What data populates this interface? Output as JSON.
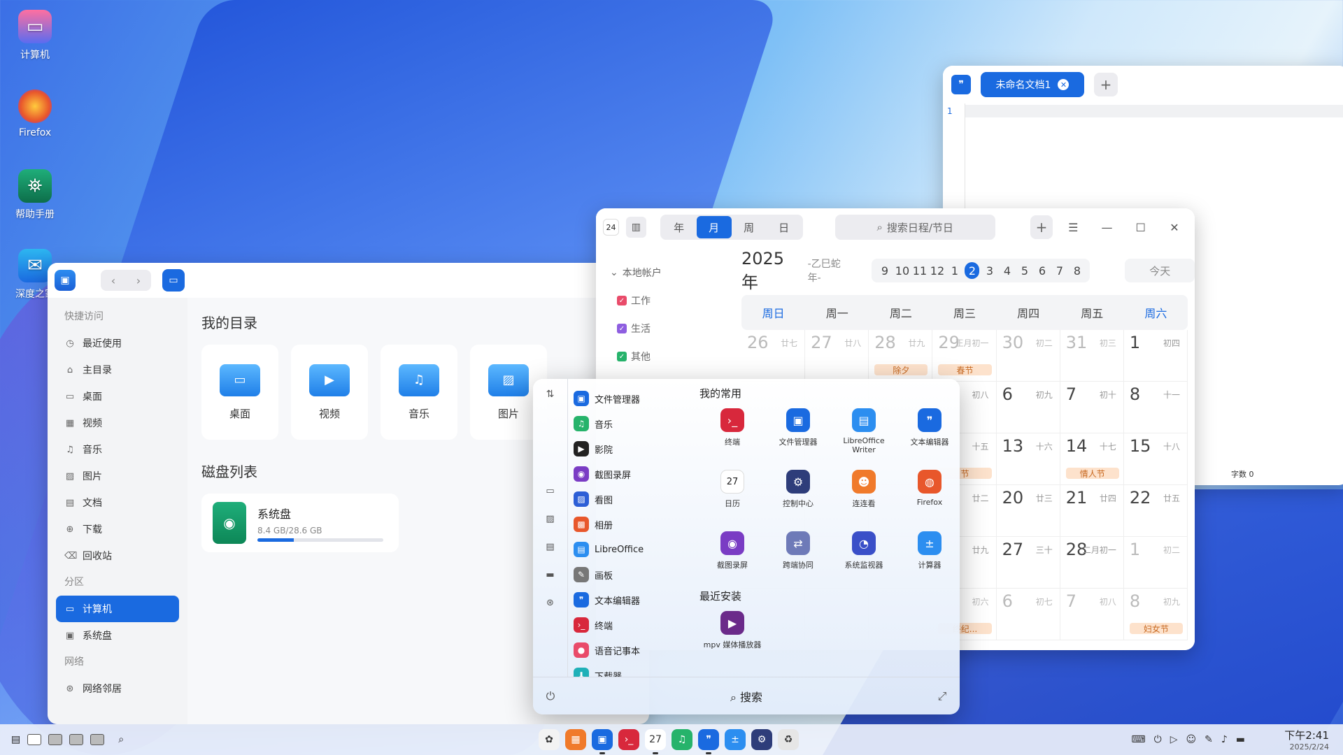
{
  "desktop": {
    "icons": [
      {
        "label": "计算机",
        "icon": "monitor-icon"
      },
      {
        "label": "Firefox",
        "icon": "firefox-icon"
      },
      {
        "label": "帮助手册",
        "icon": "manual-icon"
      },
      {
        "label": "深度之家",
        "icon": "deepin-home-icon"
      }
    ]
  },
  "file_manager": {
    "sidebar": {
      "quick_access": "快捷访问",
      "items": [
        "最近使用",
        "主目录",
        "桌面",
        "视频",
        "音乐",
        "图片",
        "文档",
        "下载",
        "回收站"
      ],
      "partitions_header": "分区",
      "partitions": [
        "计算机",
        "系统盘"
      ],
      "network_header": "网络",
      "network": [
        "网络邻居"
      ]
    },
    "my_dir_title": "我的目录",
    "folders": [
      "桌面",
      "视频",
      "音乐",
      "图片"
    ],
    "disk_title": "磁盘列表",
    "disk": {
      "name": "系统盘",
      "size": "8.4 GB/28.6 GB",
      "used_fraction": 0.29
    }
  },
  "text_editor": {
    "tab": "未命名文档1",
    "line_number": "1",
    "status": "字数 0"
  },
  "calendar": {
    "logo_text": "24",
    "views": [
      "年",
      "月",
      "周",
      "日"
    ],
    "active_view": "月",
    "search_placeholder": "搜索日程/节日",
    "account": "本地帐户",
    "types": [
      {
        "label": "工作",
        "color": "#e94b6a"
      },
      {
        "label": "生活",
        "color": "#8e5ee0"
      },
      {
        "label": "其他",
        "color": "#26b36b"
      }
    ],
    "year": "2025年",
    "ganzhi": "-乙巳蛇年-",
    "months": [
      "9",
      "10",
      "11",
      "12",
      "1",
      "2",
      "3",
      "4",
      "5",
      "6",
      "7",
      "8"
    ],
    "active_month": "2",
    "today": "今天",
    "weekdays": [
      "周日",
      "周一",
      "周二",
      "周三",
      "周四",
      "周五",
      "周六"
    ],
    "cells": [
      {
        "d": "26",
        "l": "廿七",
        "dim": true
      },
      {
        "d": "27",
        "l": "廿八",
        "dim": true
      },
      {
        "d": "28",
        "l": "廿九",
        "dim": true,
        "tag": "除夕"
      },
      {
        "d": "29",
        "l": "正月初一",
        "dim": true,
        "tag": "春节"
      },
      {
        "d": "30",
        "l": "初二",
        "dim": true
      },
      {
        "d": "31",
        "l": "初三",
        "dim": true
      },
      {
        "d": "1",
        "l": "初四"
      },
      {
        "d": "",
        "l": ""
      },
      {
        "d": "",
        "l": ""
      },
      {
        "d": "",
        "l": ""
      },
      {
        "d": "",
        "l": "初八"
      },
      {
        "d": "6",
        "l": "初九"
      },
      {
        "d": "7",
        "l": "初十"
      },
      {
        "d": "8",
        "l": "十一"
      },
      {
        "d": "",
        "l": ""
      },
      {
        "d": "",
        "l": ""
      },
      {
        "d": "",
        "l": ""
      },
      {
        "d": "",
        "l": "十五",
        "tag": "节"
      },
      {
        "d": "13",
        "l": "十六"
      },
      {
        "d": "14",
        "l": "十七",
        "tag": "情人节"
      },
      {
        "d": "15",
        "l": "十八"
      },
      {
        "d": "",
        "l": ""
      },
      {
        "d": "",
        "l": ""
      },
      {
        "d": "",
        "l": ""
      },
      {
        "d": "",
        "l": "廿二"
      },
      {
        "d": "20",
        "l": "廿三"
      },
      {
        "d": "21",
        "l": "廿四"
      },
      {
        "d": "22",
        "l": "廿五"
      },
      {
        "d": "",
        "l": ""
      },
      {
        "d": "",
        "l": ""
      },
      {
        "d": "",
        "l": ""
      },
      {
        "d": "",
        "l": "廿九"
      },
      {
        "d": "27",
        "l": "三十"
      },
      {
        "d": "28",
        "l": "二月初一"
      },
      {
        "d": "1",
        "l": "初二",
        "dim": true
      },
      {
        "d": "",
        "l": ""
      },
      {
        "d": "",
        "l": ""
      },
      {
        "d": "",
        "l": ""
      },
      {
        "d": "",
        "l": "初六",
        "dim": true,
        "tag": "终纪..."
      },
      {
        "d": "6",
        "l": "初七",
        "dim": true
      },
      {
        "d": "7",
        "l": "初八",
        "dim": true
      },
      {
        "d": "8",
        "l": "初九",
        "dim": true,
        "tag": "妇女节"
      }
    ]
  },
  "launcher": {
    "list": [
      {
        "label": "文件管理器",
        "icon": "file-manager-icon",
        "color": "#1a6ae0"
      },
      {
        "label": "音乐",
        "icon": "music-icon",
        "color": "#26b36b"
      },
      {
        "label": "影院",
        "icon": "movie-icon",
        "color": "#222"
      },
      {
        "label": "截图录屏",
        "icon": "screenshot-icon",
        "color": "#7a3cc4"
      },
      {
        "label": "看图",
        "icon": "image-viewer-icon",
        "color": "#2d5fd6"
      },
      {
        "label": "相册",
        "icon": "album-icon",
        "color": "#e8572b"
      },
      {
        "label": "LibreOffice",
        "icon": "libreoffice-icon",
        "color": "#2c8ef0"
      },
      {
        "label": "画板",
        "icon": "draw-icon",
        "color": "#777"
      },
      {
        "label": "文本编辑器",
        "icon": "text-editor-icon",
        "color": "#1a6ae0"
      },
      {
        "label": "终端",
        "icon": "terminal-icon",
        "color": "#d8283c"
      },
      {
        "label": "语音记事本",
        "icon": "voice-note-icon",
        "color": "#e94b6a"
      },
      {
        "label": "下载器",
        "icon": "downloader-icon",
        "color": "#1fb0b8"
      }
    ],
    "favorites_title": "我的常用",
    "favorites": [
      {
        "label": "终端",
        "icon": "terminal-icon",
        "color": "#d8283c"
      },
      {
        "label": "文件管理器",
        "icon": "file-manager-icon",
        "color": "#1a6ae0"
      },
      {
        "label": "LibreOffice Writer",
        "icon": "writer-icon",
        "color": "#2c8ef0"
      },
      {
        "label": "文本编辑器",
        "icon": "text-editor-icon",
        "color": "#1a6ae0"
      },
      {
        "label": "日历",
        "icon": "calendar-icon",
        "color": "#ffffff"
      },
      {
        "label": "控制中心",
        "icon": "control-center-icon",
        "color": "#2e3d7a"
      },
      {
        "label": "连连看",
        "icon": "game-icon",
        "color": "#f07a2b"
      },
      {
        "label": "Firefox",
        "icon": "firefox-icon",
        "color": "#e8572b"
      },
      {
        "label": "截图录屏",
        "icon": "screenshot-icon",
        "color": "#7a3cc4"
      },
      {
        "label": "跨端协同",
        "icon": "collab-icon",
        "color": "#6e7ab8"
      },
      {
        "label": "系统监视器",
        "icon": "monitor-cpu-icon",
        "color": "#3a4fc8"
      },
      {
        "label": "计算器",
        "icon": "calculator-icon",
        "color": "#2c8ef0"
      }
    ],
    "recent_title": "最近安装",
    "recent": [
      {
        "label": "mpv 媒体播放器",
        "icon": "mpv-icon",
        "color": "#6b2a8a"
      }
    ],
    "search": "搜索"
  },
  "taskbar": {
    "apps": [
      {
        "name": "launcher-icon",
        "color": "#f3f3f3",
        "run": false
      },
      {
        "name": "app-store-icon",
        "color": "#f07a2b",
        "run": false
      },
      {
        "name": "file-manager-icon",
        "color": "#1a6ae0",
        "run": true
      },
      {
        "name": "terminal-icon",
        "color": "#d8283c",
        "run": false
      },
      {
        "name": "calendar-icon",
        "color": "#ffffff",
        "run": true
      },
      {
        "name": "music-icon",
        "color": "#26b36b",
        "run": false
      },
      {
        "name": "text-editor-icon",
        "color": "#1a6ae0",
        "run": true
      },
      {
        "name": "calculator-icon",
        "color": "#2c8ef0",
        "run": false
      },
      {
        "name": "control-center-icon",
        "color": "#2e3d7a",
        "run": false
      },
      {
        "name": "trash-icon",
        "color": "#e6e6e6",
        "run": false
      }
    ],
    "calendar_day": "27",
    "time": "下午2:41",
    "date": "2025/2/24"
  }
}
